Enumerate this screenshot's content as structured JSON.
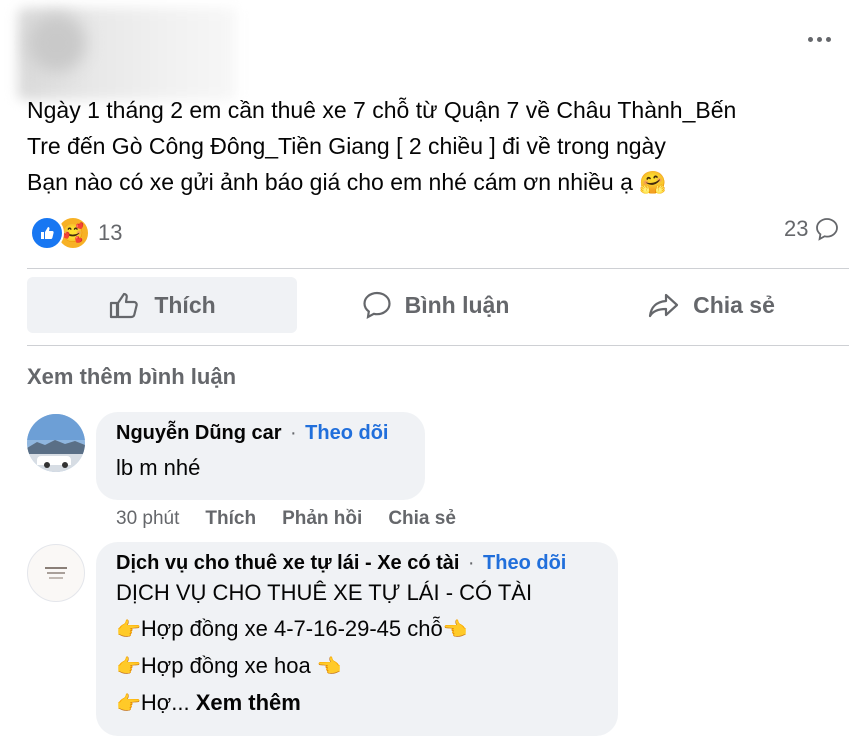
{
  "post": {
    "lines": [
      "Ngày 1 tháng 2 em cần thuê xe 7 chỗ từ Quận 7 về Châu Thành_Bến",
      "Tre đến Gò Công Đông_Tiền Giang [ 2 chiều ] đi về trong ngày",
      "Bạn nào có xe gửi ảnh báo giá cho em nhé cám ơn nhiều ạ"
    ],
    "reaction_count": "13",
    "comment_count": "23"
  },
  "actions": {
    "like": "Thích",
    "comment": "Bình luận",
    "share": "Chia sẻ"
  },
  "see_more_comments": "Xem thêm bình luận",
  "comments": [
    {
      "name": "Nguyễn Dũng car",
      "follow": "Theo dõi",
      "text": "lb m nhé",
      "time": "30 phút",
      "like": "Thích",
      "reply": "Phản hồi",
      "share": "Chia sẻ"
    },
    {
      "name": "Dịch vụ cho thuê xe tự lái - Xe có tài",
      "follow": "Theo dõi",
      "line1": "DỊCH VỤ CHO THUÊ XE TỰ LÁI - CÓ TÀI",
      "line2": "Hợp đồng xe 4-7-16-29-45 chỗ",
      "line3": "Hợp đồng xe hoa",
      "line4": "Hợ...",
      "see_more": "Xem thêm"
    }
  ],
  "icons": {
    "reaction_like": "thumbs-up-icon",
    "reaction_care": "care-emoji-icon",
    "hug": "hugging-face-emoji",
    "pointing": "backhand-index-pointing-right"
  },
  "colors": {
    "accent": "#1877f2",
    "link": "#216fdb",
    "muted": "#65676b",
    "bubble": "#f0f2f5"
  }
}
